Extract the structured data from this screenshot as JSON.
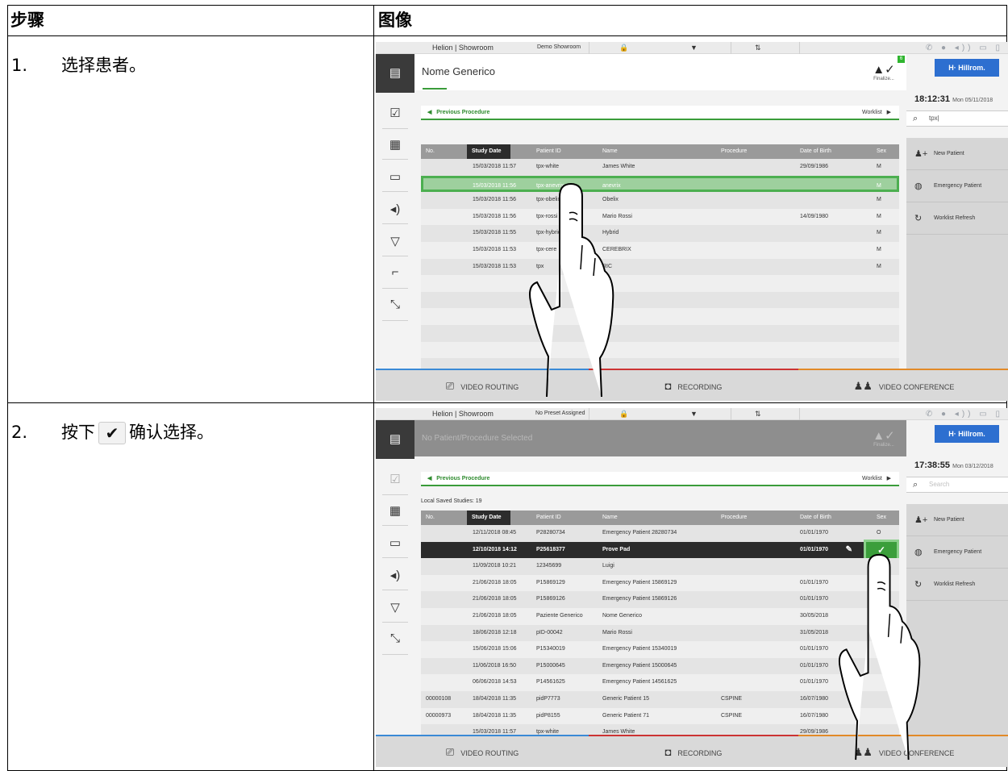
{
  "table_header": {
    "steps": "步骤",
    "image": "图像"
  },
  "steps": [
    {
      "number": "1.",
      "text": "选择患者。"
    },
    {
      "number": "2.",
      "text_before": "按下",
      "icon": "checkmark-icon",
      "glyph": "✔",
      "text_after": "确认选择。"
    }
  ],
  "shot1": {
    "topbar": {
      "left": "Helion | Showroom",
      "preset": "Demo Showroom"
    },
    "patient_name": "Nome Generico",
    "finalize": "Finalize...",
    "badge": "6",
    "logo": "H· Hillrom.",
    "time": "18:12:31",
    "date": "Mon 05/11/2018",
    "search_value": "tpx|",
    "prev": "Previous Procedure",
    "worklist": "Worklist",
    "columns": [
      "No.",
      "Study Date",
      "Patient ID",
      "Name",
      "Procedure",
      "Date of Birth",
      "Sex"
    ],
    "rows": [
      {
        "no": "",
        "date": "15/03/2018 11:57",
        "pid": "tpx-white",
        "name": "James White",
        "proc": "",
        "dob": "29/09/1986",
        "sex": "M"
      },
      {
        "no": "",
        "date": "15/03/2018 11:56",
        "pid": "tpx-anevrix",
        "name": "anevrix",
        "proc": "",
        "dob": "",
        "sex": "M"
      },
      {
        "no": "",
        "date": "15/03/2018 11:56",
        "pid": "tpx-obelix",
        "name": "Obelix",
        "proc": "",
        "dob": "",
        "sex": "M"
      },
      {
        "no": "",
        "date": "15/03/2018 11:56",
        "pid": "tpx-rossi",
        "name": "Mario Rossi",
        "proc": "",
        "dob": "14/09/1980",
        "sex": "M"
      },
      {
        "no": "",
        "date": "15/03/2018 11:55",
        "pid": "tpx-hybrid",
        "name": "Hybrid",
        "proc": "",
        "dob": "",
        "sex": "M"
      },
      {
        "no": "",
        "date": "15/03/2018 11:53",
        "pid": "tpx-cere",
        "name": "CEREBRIX",
        "proc": "",
        "dob": "",
        "sex": "M"
      },
      {
        "no": "",
        "date": "15/03/2018 11:53",
        "pid": "tpx",
        "name": "RIC",
        "proc": "",
        "dob": "",
        "sex": "M"
      },
      {
        "no": "",
        "date": "",
        "pid": "",
        "name": "",
        "proc": "",
        "dob": "",
        "sex": ""
      },
      {
        "no": "",
        "date": "",
        "pid": "",
        "name": "",
        "proc": "",
        "dob": "",
        "sex": ""
      },
      {
        "no": "",
        "date": "",
        "pid": "",
        "name": "",
        "proc": "",
        "dob": "",
        "sex": ""
      },
      {
        "no": "",
        "date": "",
        "pid": "",
        "name": "",
        "proc": "",
        "dob": "",
        "sex": ""
      },
      {
        "no": "",
        "date": "",
        "pid": "",
        "name": "",
        "proc": "",
        "dob": "",
        "sex": ""
      },
      {
        "no": "",
        "date": "",
        "pid": "",
        "name": "",
        "proc": "",
        "dob": "",
        "sex": ""
      }
    ]
  },
  "shot2": {
    "topbar": {
      "left": "Helion | Showroom",
      "preset": "No Preset Assigned"
    },
    "patient_name": "No Patient/Procedure Selected",
    "finalize": "Finalize...",
    "logo": "H· Hillrom.",
    "time": "17:38:55",
    "date": "Mon 03/12/2018",
    "search_placeholder": "Search",
    "prev": "Previous Procedure",
    "worklist": "Worklist",
    "saved": "Local Saved Studies: 19",
    "columns": [
      "No.",
      "Study Date",
      "Patient ID",
      "Name",
      "Procedure",
      "Date of Birth",
      "Sex"
    ],
    "rows": [
      {
        "no": "",
        "date": "12/11/2018 08:45",
        "pid": "P28280734",
        "name": "Emergency Patient 28280734",
        "proc": "",
        "dob": "01/01/1970",
        "sex": "O"
      },
      {
        "no": "",
        "date": "12/10/2018 14:12",
        "pid": "P25618377",
        "name": "Prove Pad",
        "proc": "",
        "dob": "01/01/1970",
        "sex": ""
      },
      {
        "no": "",
        "date": "11/09/2018 10:21",
        "pid": "12345699",
        "name": "Luigi",
        "proc": "",
        "dob": "",
        "sex": "M"
      },
      {
        "no": "",
        "date": "21/06/2018 18:05",
        "pid": "P15869129",
        "name": "Emergency Patient 15869129",
        "proc": "",
        "dob": "01/01/1970",
        "sex": "O"
      },
      {
        "no": "",
        "date": "21/06/2018 18:05",
        "pid": "P15869126",
        "name": "Emergency Patient 15869126",
        "proc": "",
        "dob": "01/01/1970",
        "sex": "O"
      },
      {
        "no": "",
        "date": "21/06/2018 18:05",
        "pid": "Paziente Generico",
        "name": "Nome Generico",
        "proc": "",
        "dob": "30/05/2018",
        "sex": ""
      },
      {
        "no": "",
        "date": "18/06/2018 12:18",
        "pid": "pID-00042",
        "name": "Mario Rossi",
        "proc": "",
        "dob": "31/05/2018",
        "sex": ""
      },
      {
        "no": "",
        "date": "15/06/2018 15:06",
        "pid": "P15340019",
        "name": "Emergency Patient 15340019",
        "proc": "",
        "dob": "01/01/1970",
        "sex": ""
      },
      {
        "no": "",
        "date": "11/06/2018 16:50",
        "pid": "P15000645",
        "name": "Emergency Patient 15000645",
        "proc": "",
        "dob": "01/01/1970",
        "sex": ""
      },
      {
        "no": "",
        "date": "06/06/2018 14:53",
        "pid": "P14561625",
        "name": "Emergency Patient 14561625",
        "proc": "",
        "dob": "01/01/1970",
        "sex": ""
      },
      {
        "no": "00000108",
        "date": "18/04/2018 11:35",
        "pid": "pidP7773",
        "name": "Generic Patient 15",
        "proc": "CSPINE",
        "dob": "16/07/1980",
        "sex": ""
      },
      {
        "no": "00000973",
        "date": "18/04/2018 11:35",
        "pid": "pidP8155",
        "name": "Generic Patient 71",
        "proc": "CSPINE",
        "dob": "16/07/1980",
        "sex": ""
      },
      {
        "no": "",
        "date": "15/03/2018 11:57",
        "pid": "tpx-white",
        "name": "James White",
        "proc": "",
        "dob": "29/09/1986",
        "sex": ""
      }
    ]
  },
  "right_buttons": [
    "New Patient",
    "Emergency Patient",
    "Worklist Refresh"
  ],
  "bottom_buttons": [
    "VIDEO ROUTING",
    "RECORDING",
    "VIDEO CONFERENCE"
  ],
  "colors": {
    "accent_green": "#3a9c3a",
    "video_routing": "#3a8ad6",
    "recording": "#cc3333",
    "video_conference": "#e28a28"
  }
}
